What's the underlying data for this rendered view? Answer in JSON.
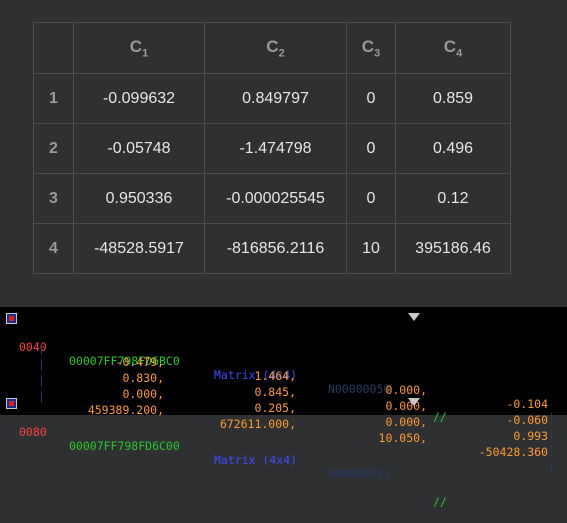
{
  "table": {
    "columns": [
      {
        "name": "C",
        "sub": "1"
      },
      {
        "name": "C",
        "sub": "2"
      },
      {
        "name": "C",
        "sub": "3"
      },
      {
        "name": "C",
        "sub": "4"
      }
    ],
    "rows": [
      {
        "index": "1",
        "cells": [
          "-0.099632",
          "0.849797",
          "0",
          "0.859"
        ]
      },
      {
        "index": "2",
        "cells": [
          "-0.05748",
          "-1.474798",
          "0",
          "0.496"
        ]
      },
      {
        "index": "3",
        "cells": [
          "0.950336",
          "-0.000025545",
          "0",
          "0.12"
        ]
      },
      {
        "index": "4",
        "cells": [
          "-48528.5917",
          "-816856.2116",
          "10",
          "395186.46"
        ]
      }
    ]
  },
  "console": {
    "entries": [
      {
        "offset": "0040",
        "address": "00007FF798FD6BC0",
        "type": "Matrix (4x4)",
        "id": "N00000050",
        "comment": "//"
      },
      {
        "offset": "0080",
        "address": "00007FF798FD6C00",
        "type": "Matrix (4x4)",
        "id": "N00000051",
        "comment": "//"
      }
    ],
    "matrix_rows": [
      [
        "-0.479,",
        "1.464,",
        "0.000,",
        "-0.104"
      ],
      [
        "0.830,",
        "0.845,",
        "0.000,",
        "-0.060"
      ],
      [
        "0.000,",
        "0.205,",
        "0.000,",
        "0.993"
      ],
      [
        "459389.200,",
        "672611.000,",
        "10.050,",
        "-50428.360"
      ]
    ]
  }
}
